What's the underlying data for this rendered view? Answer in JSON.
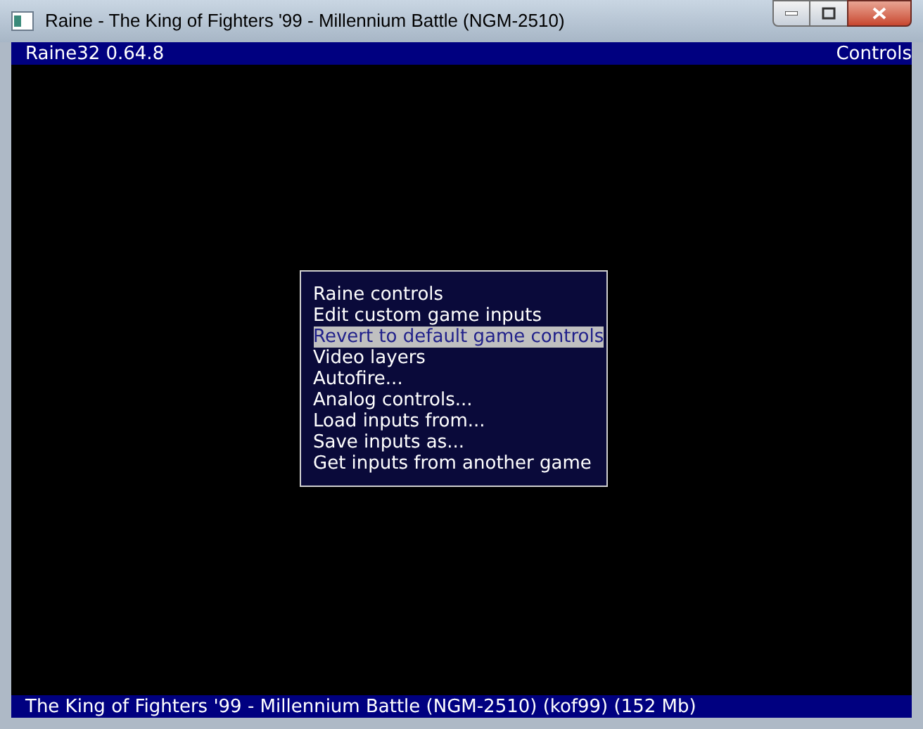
{
  "window": {
    "title": "Raine - The King of Fighters '99 - Millennium Battle (NGM-2510)"
  },
  "header": {
    "left": "Raine32 0.64.8",
    "right": "Controls"
  },
  "menu": {
    "items": [
      {
        "label": "Raine controls",
        "selected": false
      },
      {
        "label": "Edit custom game inputs",
        "selected": false
      },
      {
        "label": "Revert to default game controls",
        "selected": true
      },
      {
        "label": "Video layers",
        "selected": false
      },
      {
        "label": "Autofire...",
        "selected": false
      },
      {
        "label": "Analog controls...",
        "selected": false
      },
      {
        "label": "Load inputs from...",
        "selected": false
      },
      {
        "label": "Save inputs as...",
        "selected": false
      },
      {
        "label": "Get inputs from another game",
        "selected": false
      }
    ]
  },
  "status_bar": "The King of Fighters '99 - Millennium Battle (NGM-2510) (kof99) (152 Mb)"
}
